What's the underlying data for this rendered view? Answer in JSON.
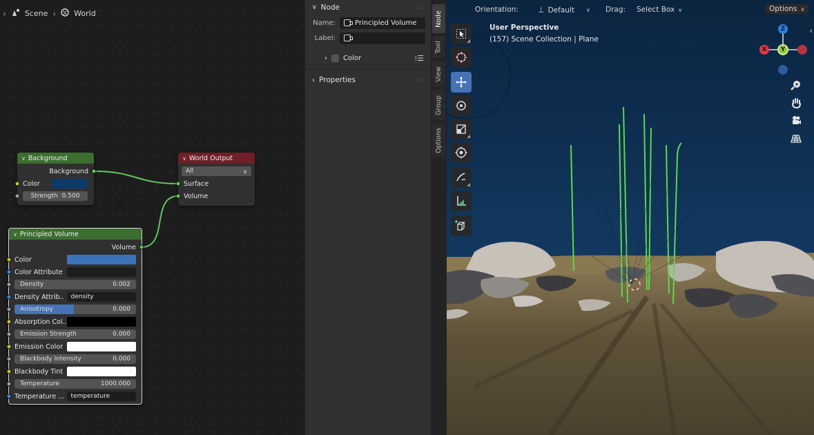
{
  "breadcrumb": {
    "scene": "Scene",
    "world": "World"
  },
  "nodes": {
    "background": {
      "title": "Background",
      "output": "Background",
      "color_label": "Color",
      "color_value": "#0c3a6b",
      "strength_label": "Strength",
      "strength_value": "0.500"
    },
    "world_output": {
      "title": "World Output",
      "target": "All",
      "inputs": [
        "Surface",
        "Volume"
      ]
    },
    "principled_volume": {
      "title": "Principled Volume",
      "output": "Volume",
      "color_label": "Color",
      "color_value": "#3b74b9",
      "color_attribute_label": "Color Attribute",
      "density_label": "Density",
      "density_value": "0.002",
      "density_attribute_label": "Density Attrib..",
      "density_attribute_value": "density",
      "anisotropy_label": "Anisotropy",
      "anisotropy_value": "0.000",
      "absorption_label": "Absorption Col...",
      "absorption_value": "#000000",
      "emission_strength_label": "Emission Strength",
      "emission_strength_value": "0.000",
      "emission_color_label": "Emission Color",
      "emission_color_value": "#ffffff",
      "blackbody_intensity_label": "Blackbody Intensity",
      "blackbody_intensity_value": "0.000",
      "blackbody_tint_label": "Blackbody Tint",
      "blackbody_tint_value": "#ffffff",
      "temperature_label": "Temperature",
      "temperature_value": "1000.000",
      "temperature_attr_label": "Temperature ...",
      "temperature_attr_value": "temperature"
    }
  },
  "sidebar": {
    "node_panel": "Node",
    "name_label": "Name:",
    "name_value": "Principled Volume",
    "label_label": "Label:",
    "label_value": "",
    "color_panel": "Color",
    "properties_panel": "Properties",
    "tabs": [
      "Node",
      "Tool",
      "View",
      "Group",
      "Options"
    ],
    "active_tab": "Node"
  },
  "viewport": {
    "orientation_label": "Orientation:",
    "orientation_value": "Default",
    "drag_label": "Drag:",
    "drag_value": "Select Box",
    "options_label": "Options",
    "perspective": "User Perspective",
    "collection": "(157) Scene Collection | Plane",
    "gizmo": {
      "x": "X",
      "y": "Y",
      "z": "Z"
    },
    "tools": [
      "select-box",
      "cursor",
      "move",
      "rotate",
      "scale",
      "transform",
      "annotate",
      "measure",
      "add-cube"
    ],
    "active_tool": "move",
    "nav": [
      "zoom",
      "pan",
      "camera",
      "grid"
    ]
  },
  "colors": {
    "background_header": "#3b6e2f",
    "world_output_header": "#6e1f27",
    "volume_header": "#3b6e2f",
    "sky": "#0e2a47",
    "ground": "#76694f",
    "grass": "#5fd84a",
    "axis_x": "#e2384b",
    "axis_y": "#8bc83b",
    "axis_z": "#2d7fdf",
    "active_tool": "#4772b3"
  }
}
